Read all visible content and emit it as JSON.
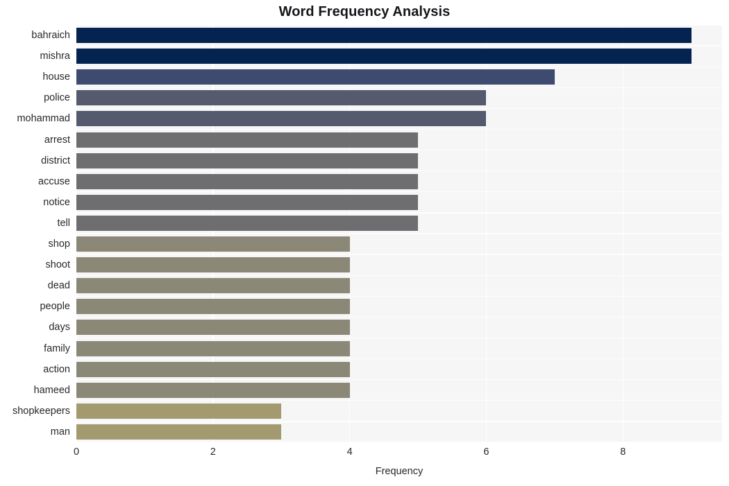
{
  "chart_data": {
    "type": "bar",
    "orientation": "horizontal",
    "title": "Word Frequency Analysis",
    "xlabel": "Frequency",
    "ylabel": "",
    "categories": [
      "bahraich",
      "mishra",
      "house",
      "police",
      "mohammad",
      "arrest",
      "district",
      "accuse",
      "notice",
      "tell",
      "shop",
      "shoot",
      "dead",
      "people",
      "days",
      "family",
      "action",
      "hameed",
      "shopkeepers",
      "man"
    ],
    "values": [
      9,
      9,
      7,
      6,
      6,
      5,
      5,
      5,
      5,
      5,
      4,
      4,
      4,
      4,
      4,
      4,
      4,
      4,
      3,
      3
    ],
    "bar_colors": [
      "#042350",
      "#042350",
      "#3e4a70",
      "#565a6e",
      "#565a6e",
      "#6e6e70",
      "#6e6e70",
      "#6e6e70",
      "#6e6e70",
      "#6e6e70",
      "#8c8878",
      "#8c8878",
      "#8c8878",
      "#8c8878",
      "#8c8878",
      "#8c8878",
      "#8c8878",
      "#8c8878",
      "#a39b6f",
      "#a39b6f"
    ],
    "xlim": [
      0,
      9.45
    ],
    "xticks": [
      0,
      2,
      4,
      6,
      8
    ],
    "xticklabels": [
      "0",
      "2",
      "4",
      "6",
      "8"
    ],
    "grid": true,
    "grid_color": "#ffffff",
    "plot_background": "#f6f6f7",
    "figure_background": "#ffffff",
    "legend": null,
    "series": [
      {
        "name": "Frequency",
        "values": [
          9,
          9,
          7,
          6,
          6,
          5,
          5,
          5,
          5,
          5,
          4,
          4,
          4,
          4,
          4,
          4,
          4,
          4,
          3,
          3
        ]
      }
    ]
  }
}
